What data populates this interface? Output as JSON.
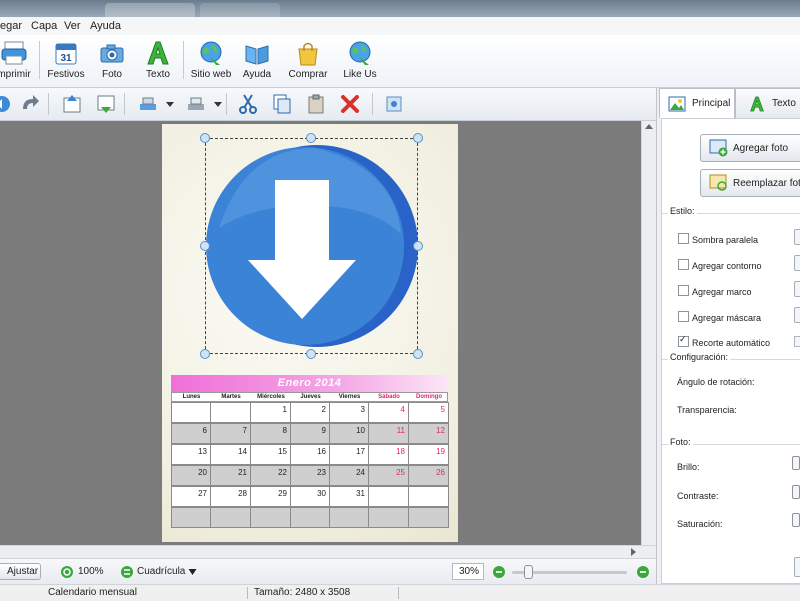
{
  "menu": {
    "items": [
      "egar",
      "Capa",
      "Ver",
      "Ayuda"
    ]
  },
  "ribbon": {
    "buttons": [
      "mprimir",
      "Festivos",
      "Foto",
      "Texto",
      "Sitio web",
      "Ayuda",
      "Comprar",
      "Like Us"
    ],
    "calendar_icon_day": "31"
  },
  "calendar": {
    "header": "Enero 2014",
    "days": [
      "Lunes",
      "Martes",
      "Miércoles",
      "Jueves",
      "Viernes",
      "Sábado",
      "Domingo"
    ],
    "weeks": [
      [
        "",
        "",
        "1",
        "2",
        "3",
        "4",
        "5"
      ],
      [
        "6",
        "7",
        "8",
        "9",
        "10",
        "11",
        "12"
      ],
      [
        "13",
        "14",
        "15",
        "16",
        "17",
        "18",
        "19"
      ],
      [
        "20",
        "21",
        "22",
        "23",
        "24",
        "25",
        "26"
      ],
      [
        "27",
        "28",
        "29",
        "30",
        "31",
        "",
        ""
      ],
      [
        "",
        "",
        "",
        "",
        "",
        "",
        ""
      ]
    ],
    "colors": {
      "header": "#f06fd8",
      "weekend": "#e0266d",
      "grey_row": "#cfcfcf",
      "white_row": "#ffffff"
    }
  },
  "panel": {
    "tabs": [
      "Principal",
      "Texto"
    ],
    "add_photo": "Agregar foto",
    "replace_photo": "Reemplazar foto",
    "style_title": "Estilo:",
    "style_options": [
      {
        "label": "Sombra paralela",
        "checked": false
      },
      {
        "label": "Agregar contorno",
        "checked": false
      },
      {
        "label": "Agregar marco",
        "checked": false
      },
      {
        "label": "Agregar máscara",
        "checked": false
      },
      {
        "label": "Recorte automático",
        "checked": true
      }
    ],
    "config_title": "Configuración:",
    "rotation_label": "Ángulo de rotación:",
    "transparency_label": "Transparencia:",
    "photo_title": "Foto:",
    "brightness_label": "Brillo:",
    "contrast_label": "Contraste:",
    "saturation_label": "Saturación:"
  },
  "status": {
    "fit_label": "Ajustar",
    "zoom_100": "100%",
    "grid_label": "Cuadrícula",
    "zoom_value": "30%",
    "zoom_slider_level": 0.1
  },
  "info": {
    "type": "Calendario mensual",
    "size": "Tamaño: 2480 x 3508"
  },
  "accent": "#3b83d6"
}
